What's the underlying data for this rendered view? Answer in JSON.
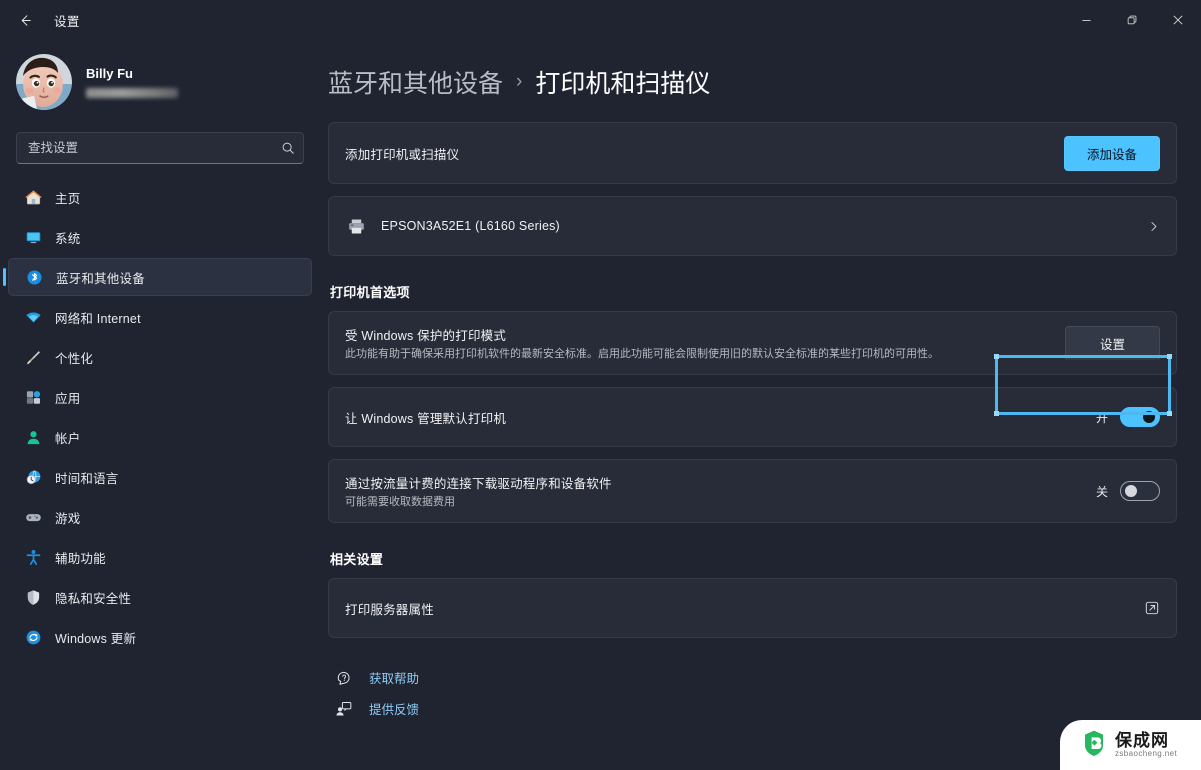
{
  "window": {
    "title": "设置",
    "back_icon": "arrow-left-icon",
    "minimize_label": "—",
    "maximize_label": "❐",
    "close_label": "✕"
  },
  "sidebar": {
    "profile": {
      "name": "Billy Fu",
      "email_masked": ""
    },
    "search": {
      "placeholder": "查找设置",
      "value": "",
      "icon": "search-icon"
    },
    "items": [
      {
        "label": "主页",
        "icon": "home-icon",
        "selected": false
      },
      {
        "label": "系统",
        "icon": "system-icon",
        "selected": false
      },
      {
        "label": "蓝牙和其他设备",
        "icon": "bluetooth-icon",
        "selected": true
      },
      {
        "label": "网络和 Internet",
        "icon": "wifi-icon",
        "selected": false
      },
      {
        "label": "个性化",
        "icon": "brush-icon",
        "selected": false
      },
      {
        "label": "应用",
        "icon": "apps-icon",
        "selected": false
      },
      {
        "label": "帐户",
        "icon": "account-icon",
        "selected": false
      },
      {
        "label": "时间和语言",
        "icon": "clock-globe-icon",
        "selected": false
      },
      {
        "label": "游戏",
        "icon": "gamepad-icon",
        "selected": false
      },
      {
        "label": "辅助功能",
        "icon": "accessibility-icon",
        "selected": false
      },
      {
        "label": "隐私和安全性",
        "icon": "shield-icon",
        "selected": false
      },
      {
        "label": "Windows 更新",
        "icon": "update-icon",
        "selected": false
      }
    ]
  },
  "breadcrumb": {
    "parent": "蓝牙和其他设备",
    "separator": "›",
    "current": "打印机和扫描仪"
  },
  "main": {
    "add_printer": {
      "title": "添加打印机或扫描仪",
      "button_label": "添加设备"
    },
    "devices": [
      {
        "name": "EPSON3A52E1 (L6160 Series)",
        "icon": "printer-icon",
        "chevron": "chevron-right-icon"
      }
    ],
    "preferences_section": {
      "title": "打印机首选项",
      "rows": [
        {
          "title": "受 Windows 保护的打印模式",
          "subtitle": "此功能有助于确保采用打印机软件的最新安全标准。启用此功能可能会限制使用旧的默认安全标准的某些打印机的可用性。",
          "action_label": "设置",
          "action_kind": "button",
          "highlighted": true
        },
        {
          "title": "让 Windows 管理默认打印机",
          "subtitle": "",
          "toggle_state_label": "开",
          "toggle_on": true,
          "action_kind": "toggle"
        },
        {
          "title": "通过按流量计费的连接下载驱动程序和设备软件",
          "subtitle": "可能需要收取数据费用",
          "toggle_state_label": "关",
          "toggle_on": false,
          "action_kind": "toggle"
        }
      ]
    },
    "related_section": {
      "title": "相关设置",
      "rows": [
        {
          "title": "打印服务器属性",
          "icon": "external-link-icon"
        }
      ]
    },
    "footer_links": [
      {
        "label": "获取帮助",
        "icon": "help-icon"
      },
      {
        "label": "提供反馈",
        "icon": "feedback-icon"
      }
    ]
  },
  "watermark": {
    "title": "保成网",
    "subtitle": "zsbaocheng.net",
    "icon": "shield-logo-icon",
    "color": "#27b760"
  },
  "colors": {
    "accent": "#4cc2ff",
    "highlight": "#4cb9f0",
    "window_bg": "#1f2430",
    "card_bg": "#272c38",
    "link": "#8ecbf5"
  }
}
